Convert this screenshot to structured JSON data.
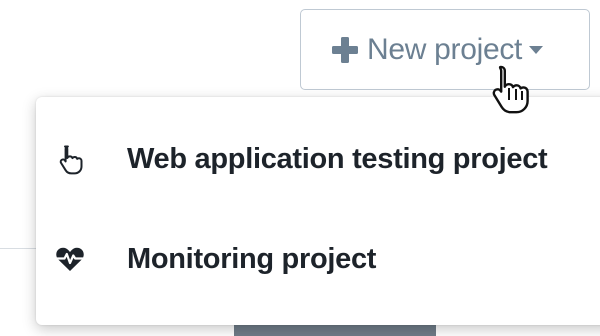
{
  "new_project_button": {
    "label": "New project",
    "icon": "plus-icon",
    "caret_icon": "caret-down-icon"
  },
  "dropdown": {
    "items": [
      {
        "label": "Web application testing project",
        "icon": "hand-pointer-icon"
      },
      {
        "label": "Monitoring project",
        "icon": "heartbeat-icon"
      }
    ]
  },
  "colors": {
    "button_text": "#6c8092",
    "button_border": "#bfc9d3",
    "menu_text": "#1d232a"
  }
}
